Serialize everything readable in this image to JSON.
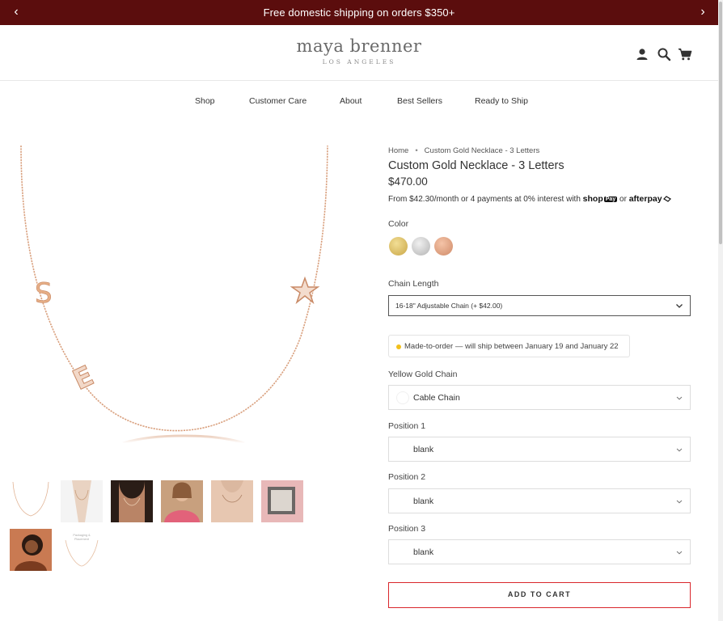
{
  "announcement": {
    "text": "Free domestic shipping on orders $350+"
  },
  "brand": {
    "name": "maya brenner",
    "location": "LOS ANGELES"
  },
  "header_icons": [
    "account-icon",
    "search-icon",
    "cart-icon"
  ],
  "nav": {
    "items": [
      "Shop",
      "Customer Care",
      "About",
      "Best Sellers",
      "Ready to Ship"
    ]
  },
  "thumbnail_notes": {
    "packaging": "Packaging & Placement"
  },
  "product": {
    "breadcrumb": [
      "Home",
      "Custom Gold Necklace - 3 Letters"
    ],
    "title": "Custom Gold Necklace - 3 Letters",
    "price": "$470.00",
    "installments": {
      "prefix": "From $42.30/month or 4 payments at 0% interest with",
      "shop": "shop",
      "pay": "Pay",
      "or": "or",
      "afterpay": "afterpay"
    },
    "color_label": "Color",
    "colors": [
      {
        "name": "Yellow Gold",
        "hex": "#d4b55a"
      },
      {
        "name": "Silver",
        "hex": "#c9c9c9"
      },
      {
        "name": "Rose Gold",
        "hex": "#d99a7d"
      }
    ],
    "chain_length": {
      "label": "Chain Length",
      "value": "16-18\" Adjustable Chain (+ $42.00)"
    },
    "made_to_order": "Made-to-order — will ship between January 19 and January 22",
    "chain_style": {
      "label": "Yellow Gold Chain",
      "value": "Cable Chain"
    },
    "positions": [
      {
        "label": "Position 1",
        "value": "blank"
      },
      {
        "label": "Position 2",
        "value": "blank"
      },
      {
        "label": "Position 3",
        "value": "blank"
      }
    ],
    "add_to_cart": "ADD TO CART"
  },
  "colors": {
    "announcement_bg": "#5b0d0d",
    "cart_border": "#d9262c",
    "rose_gold_chain": "#d9a07e",
    "status_dot": "#f2c01b"
  }
}
